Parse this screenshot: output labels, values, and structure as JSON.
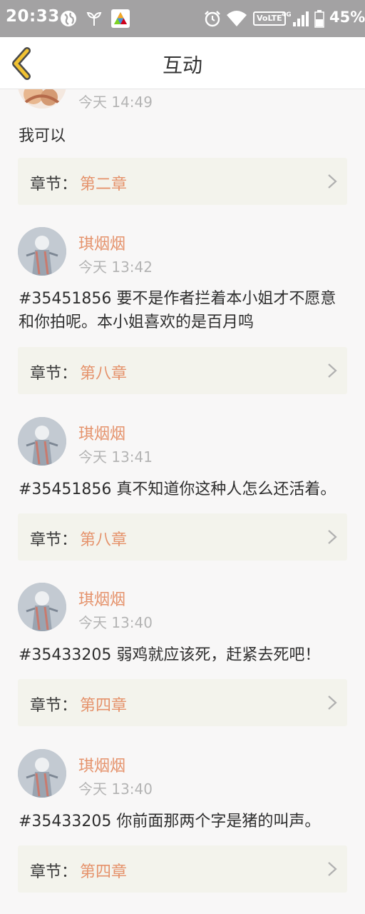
{
  "status_bar": {
    "time": "20:33",
    "volte": "VoLTE",
    "network": "4G",
    "battery": "45%"
  },
  "header": {
    "title": "互动",
    "back_icon": "chevron-left-icon"
  },
  "colors": {
    "accent": "#e5926b",
    "chapter_bg": "#f3f3ec",
    "back_arrow": "#f1c232"
  },
  "comments": [
    {
      "username": "",
      "time": "今天 14:49",
      "text": "我可以",
      "chapter_label": "章节：",
      "chapter": "第二章"
    },
    {
      "username": "琪烟烟",
      "time": "今天 13:42",
      "text": "#35451856 要不是作者拦着本小姐才不愿意和你拍呢。本小姐喜欢的是百月鸣",
      "chapter_label": "章节：",
      "chapter": "第八章"
    },
    {
      "username": "琪烟烟",
      "time": "今天 13:41",
      "text": "#35451856 真不知道你这种人怎么还活着。",
      "chapter_label": "章节：",
      "chapter": "第八章"
    },
    {
      "username": "琪烟烟",
      "time": "今天 13:40",
      "text": "#35433205 弱鸡就应该死，赶紧去死吧！",
      "chapter_label": "章节：",
      "chapter": "第四章"
    },
    {
      "username": "琪烟烟",
      "time": "今天 13:40",
      "text": "#35433205 你前面那两个字是猪的叫声。",
      "chapter_label": "章节：",
      "chapter": "第四章"
    }
  ]
}
